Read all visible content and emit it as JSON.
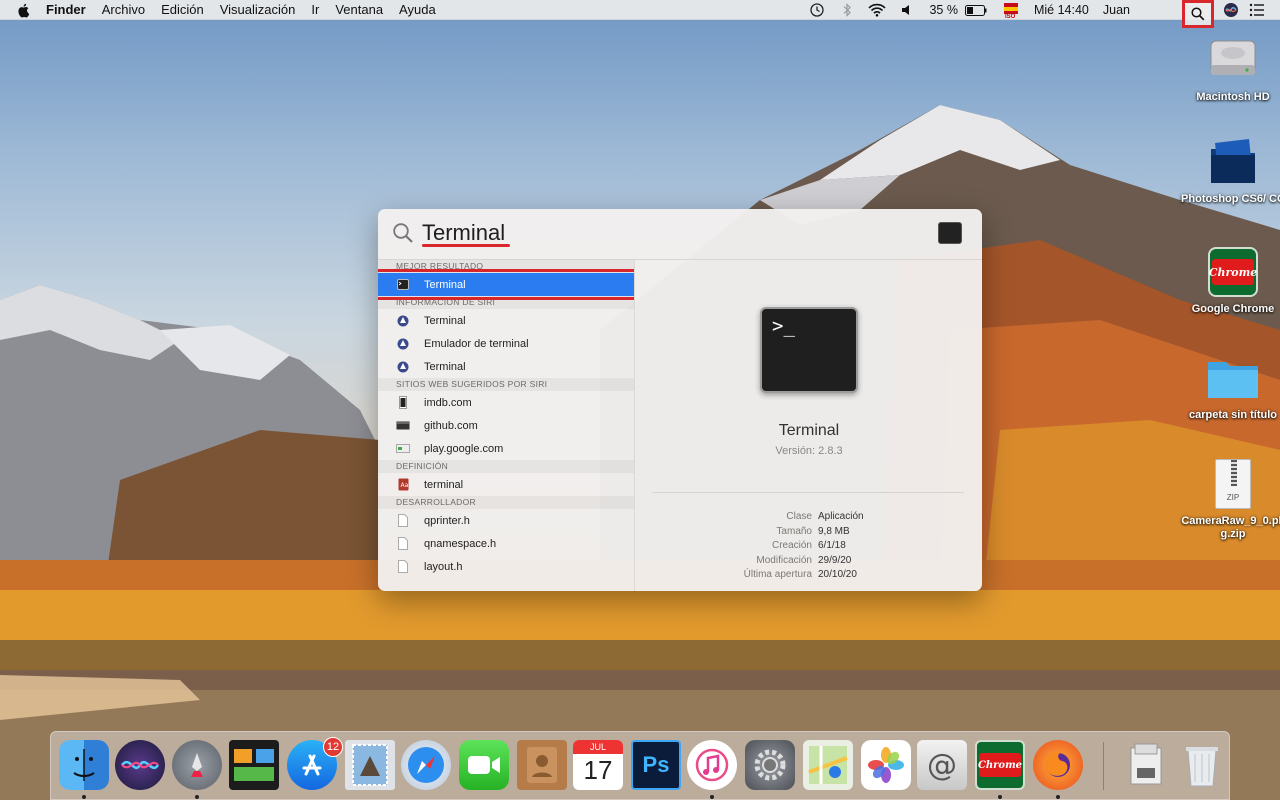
{
  "menubar": {
    "app_name": "Finder",
    "menus": [
      "Archivo",
      "Edición",
      "Visualización",
      "Ir",
      "Ventana",
      "Ayuda"
    ],
    "battery": "35 %",
    "input_badge": "ISO",
    "datetime": "Mié 14:40",
    "user": "Juan"
  },
  "desktop": {
    "icons": [
      {
        "label": "Macintosh HD"
      },
      {
        "label": "Photoshop CS6/ CC"
      },
      {
        "label": "Google Chrome",
        "icon_text": "Chrome"
      },
      {
        "label": "carpeta sin título"
      },
      {
        "label": "CameraRaw_9_0.pk g.zip",
        "icon_text": "ZIP"
      }
    ]
  },
  "spotlight": {
    "query": "Terminal",
    "sections": {
      "best": "MEJOR RESULTADO",
      "siri": "INFORMACIÓN DE SIRI",
      "web": "SITIOS WEB SUGERIDOS POR SIRI",
      "def": "DEFINICIÓN",
      "dev": "DESARROLLADOR"
    },
    "best_result": "Terminal",
    "siri_items": [
      "Terminal",
      "Emulador de terminal",
      "Terminal"
    ],
    "web_items": [
      "imdb.com",
      "github.com",
      "play.google.com"
    ],
    "def_items": [
      "terminal"
    ],
    "dev_items": [
      "qprinter.h",
      "qnamespace.h",
      "layout.h"
    ],
    "preview": {
      "prompt": ">_",
      "name": "Terminal",
      "version": "Versión: 2.8.3",
      "meta": [
        {
          "k": "Clase",
          "v": "Aplicación"
        },
        {
          "k": "Tamaño",
          "v": "9,8 MB"
        },
        {
          "k": "Creación",
          "v": "6/1/18"
        },
        {
          "k": "Modificación",
          "v": "29/9/20"
        },
        {
          "k": "Última apertura",
          "v": "20/10/20"
        }
      ]
    }
  },
  "dock": {
    "calendar_month": "JUL",
    "calendar_day": "17",
    "appstore_badge": "12",
    "photoshop_label": "Ps",
    "chrome_label": "Chrome",
    "mail_label": "@"
  }
}
